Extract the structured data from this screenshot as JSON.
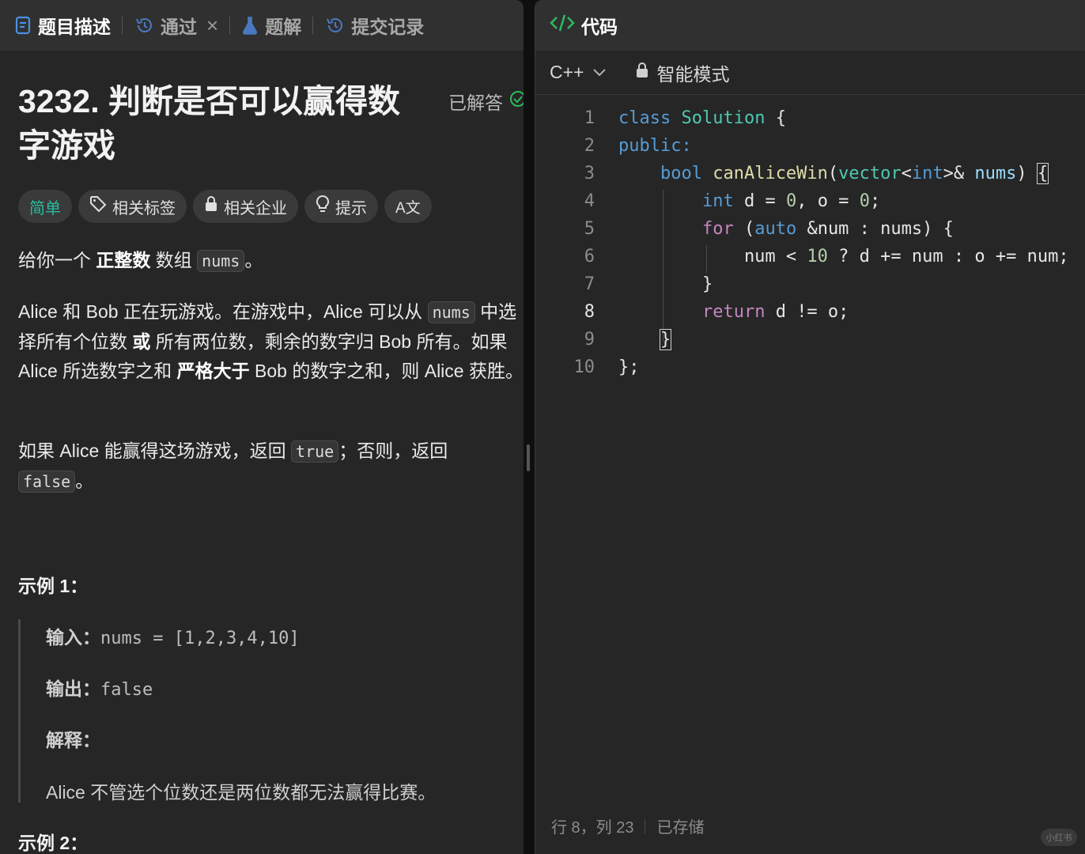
{
  "left_tabs": [
    {
      "label": "题目描述",
      "icon": "description-icon",
      "active": true
    },
    {
      "label": "通过",
      "icon": "history-icon",
      "active": false,
      "closable": true
    },
    {
      "label": "题解",
      "icon": "flask-icon",
      "active": false
    },
    {
      "label": "提交记录",
      "icon": "history-icon",
      "active": false
    }
  ],
  "problem": {
    "title": "3232. 判断是否可以赢得数字游戏",
    "status": "已解答",
    "difficulty": "简单",
    "tags": [
      {
        "label": "相关标签",
        "icon": "tag-icon"
      },
      {
        "label": "相关企业",
        "icon": "lock-icon"
      },
      {
        "label": "提示",
        "icon": "lightbulb-icon"
      },
      {
        "label": "A文",
        "icon": "translate-icon"
      }
    ],
    "desc1": {
      "pre": "给你一个 ",
      "bold": "正整数",
      "mid": " 数组 ",
      "code": "nums",
      "post": "。"
    },
    "desc2": {
      "t1": "Alice 和 Bob 正在玩游戏。在游戏中，Alice 可以从 ",
      "code": "nums",
      "t2": " 中选择所有个位数 ",
      "b1": "或",
      "t3": " 所有两位数，剩余的数字归 Bob 所有。如果 Alice 所选数字之和 ",
      "b2": "严格大于",
      "t4": " Bob 的数字之和，则 Alice 获胜。"
    },
    "desc3": {
      "t1": "如果 Alice 能赢得这场游戏，返回 ",
      "code1": "true",
      "t2": "；否则，返回 ",
      "code2": "false",
      "t3": "。"
    },
    "example1": {
      "title": "示例 1：",
      "input_label": "输入：",
      "input_value": "nums = [1,2,3,4,10]",
      "output_label": "输出：",
      "output_value": "false",
      "explain_label": "解释：",
      "explain_text": "Alice 不管选个位数还是两位数都无法赢得比赛。"
    },
    "example2": {
      "title": "示例 2："
    }
  },
  "editor": {
    "header": "代码",
    "language": "C++",
    "mode": "智能模式",
    "line_numbers": [
      "1",
      "2",
      "3",
      "4",
      "5",
      "6",
      "7",
      "8",
      "9",
      "10"
    ],
    "status_position": "行 8，列 23",
    "status_saved": "已存储"
  },
  "watermark": "小红书"
}
